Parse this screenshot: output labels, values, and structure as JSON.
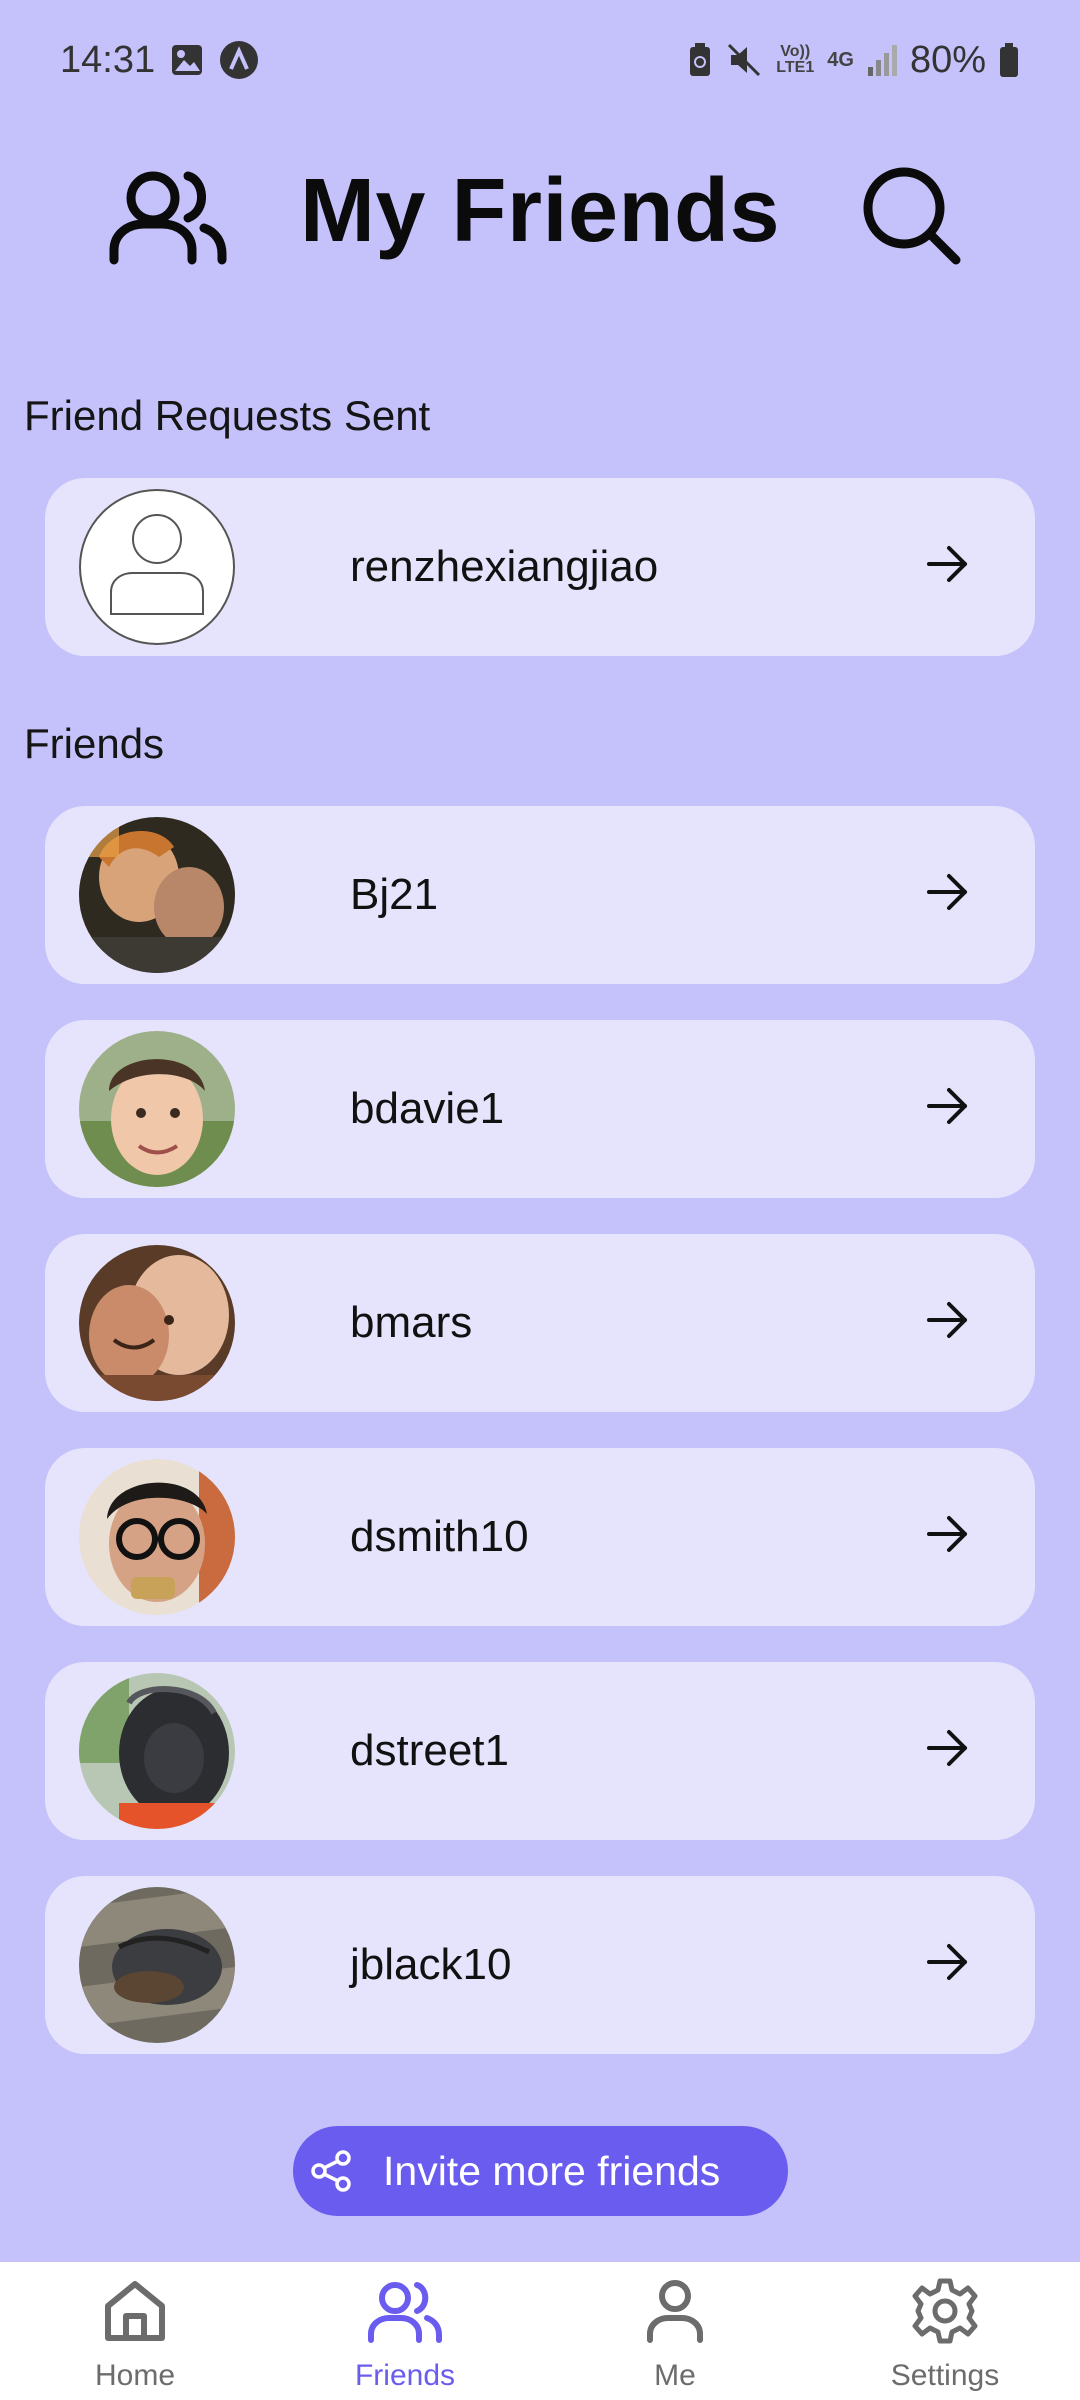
{
  "status_bar": {
    "time": "14:31",
    "volte_label": "Vo)) LTE1",
    "network_label": "4G",
    "battery_percent": "80%"
  },
  "header": {
    "title": "My Friends",
    "left_icon": "friends-icon",
    "right_icon": "search-icon"
  },
  "requests": {
    "section_label": "Friend Requests Sent",
    "items": [
      {
        "name": "renzhexiangjiao",
        "avatar": "placeholder-avatar"
      }
    ]
  },
  "friends": {
    "section_label": "Friends",
    "items": [
      {
        "name": "Bj21",
        "avatar": "photo-avatar"
      },
      {
        "name": "bdavie1",
        "avatar": "photo-avatar"
      },
      {
        "name": "bmars",
        "avatar": "photo-avatar"
      },
      {
        "name": "dsmith10",
        "avatar": "photo-avatar"
      },
      {
        "name": "dstreet1",
        "avatar": "photo-avatar"
      },
      {
        "name": "jblack10",
        "avatar": "photo-avatar"
      }
    ]
  },
  "invite_button": {
    "label": "Invite more friends",
    "icon": "share-icon"
  },
  "bottom_nav": {
    "items": [
      {
        "label": "Home",
        "icon": "home-icon",
        "active": false
      },
      {
        "label": "Friends",
        "icon": "friends-icon",
        "active": true
      },
      {
        "label": "Me",
        "icon": "user-icon",
        "active": false
      },
      {
        "label": "Settings",
        "icon": "gear-icon",
        "active": false
      }
    ]
  },
  "colors": {
    "background": "#c5c1fb",
    "card": "#e6e4fc",
    "accent": "#6b5cf0",
    "nav_background": "#ffffff"
  }
}
